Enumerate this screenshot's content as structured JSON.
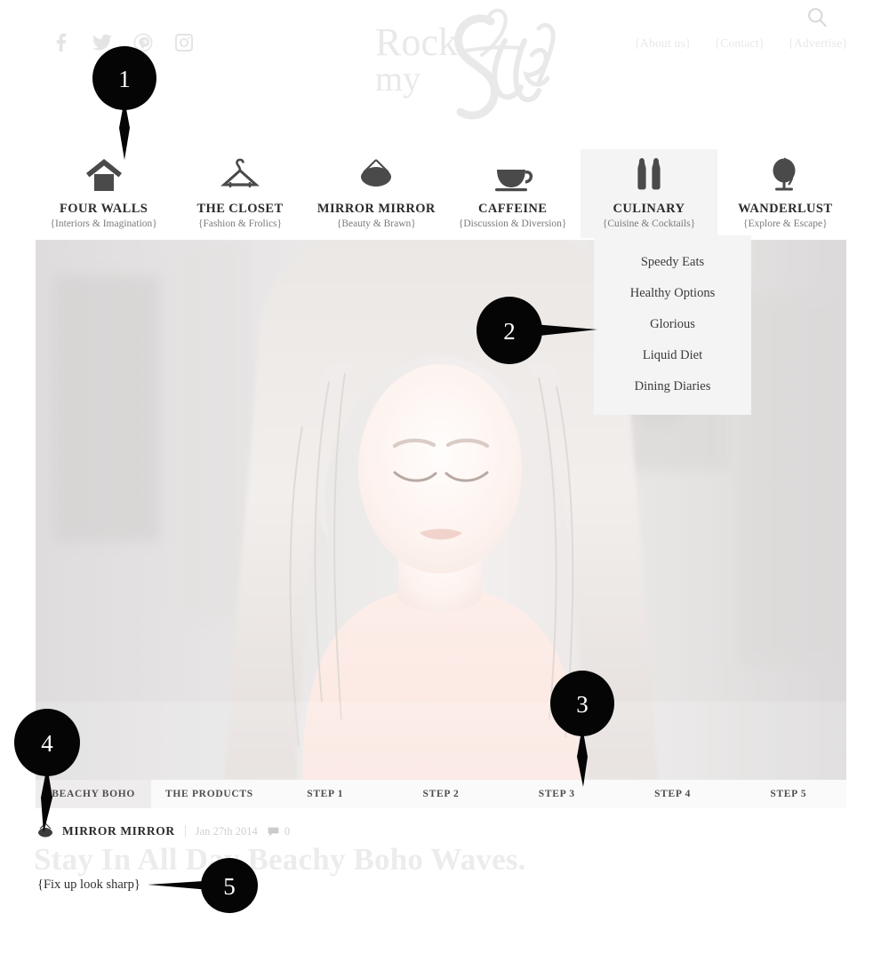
{
  "site": {
    "logo_line1": "Rock",
    "logo_line2": "my",
    "logo_script": "Style"
  },
  "social": [
    {
      "name": "facebook-icon",
      "label": "Facebook"
    },
    {
      "name": "twitter-icon",
      "label": "Twitter"
    },
    {
      "name": "pinterest-icon",
      "label": "Pinterest"
    },
    {
      "name": "instagram-icon",
      "label": "Instagram"
    }
  ],
  "utility_nav": [
    {
      "label": "{About us}"
    },
    {
      "label": "{Contact}"
    },
    {
      "label": "{Advertise}"
    }
  ],
  "search": {
    "icon": "search-icon"
  },
  "main_nav": [
    {
      "title": "FOUR WALLS",
      "sub": "{Interiors & Imagination}",
      "icon": "house-icon",
      "active": false
    },
    {
      "title": "THE CLOSET",
      "sub": "{Fashion & Frolics}",
      "icon": "hanger-icon",
      "active": false
    },
    {
      "title": "MIRROR MIRROR",
      "sub": "{Beauty & Brawn}",
      "icon": "mirror-icon",
      "active": false
    },
    {
      "title": "CAFFEINE",
      "sub": "{Discussion & Diversion}",
      "icon": "teacup-icon",
      "active": false
    },
    {
      "title": "CULINARY",
      "sub": "{Cuisine & Cocktails}",
      "icon": "shakers-icon",
      "active": true
    },
    {
      "title": "WANDERLUST",
      "sub": "{Explore & Escape}",
      "icon": "globe-icon",
      "active": false
    }
  ],
  "dropdown": {
    "parent": "CULINARY",
    "items": [
      {
        "label": "Speedy Eats"
      },
      {
        "label": "Healthy Options"
      },
      {
        "label": "Glorious"
      },
      {
        "label": "Liquid Diet"
      },
      {
        "label": "Dining Diaries"
      }
    ]
  },
  "hero": {
    "alt": "Woman with long wavy hair looking down, heavily washed-out photo"
  },
  "tabs": [
    {
      "label": "BEACHY BOHO",
      "active": true
    },
    {
      "label": "THE PRODUCTS",
      "active": false
    },
    {
      "label": "STEP 1",
      "active": false
    },
    {
      "label": "STEP 2",
      "active": false
    },
    {
      "label": "STEP 3",
      "active": false
    },
    {
      "label": "STEP 4",
      "active": false
    },
    {
      "label": "STEP 5",
      "active": false
    }
  ],
  "post": {
    "category": "MIRROR MIRROR",
    "category_icon": "mirror-icon",
    "date": "Jan 27th 2014",
    "comment_icon": "comment-icon",
    "comment_count": "0",
    "title": "Stay In All Day Beachy Boho Waves.",
    "subtitle": "{Fix up look sharp}"
  },
  "markers": [
    {
      "id": "1",
      "number": "1"
    },
    {
      "id": "2",
      "number": "2"
    },
    {
      "id": "3",
      "number": "3"
    },
    {
      "id": "4",
      "number": "4"
    },
    {
      "id": "5",
      "number": "5"
    }
  ],
  "colors": {
    "marker": "#050505",
    "nav_icon": "#4a4a4a",
    "nav_title": "#2b2b2b",
    "nav_sub": "#7a7a7a",
    "active_tab_bg": "#eeecec",
    "dropdown_bg": "#f4f4f4",
    "muted_text": "#cfcfcf",
    "logo_gray": "#e8e8e8"
  }
}
